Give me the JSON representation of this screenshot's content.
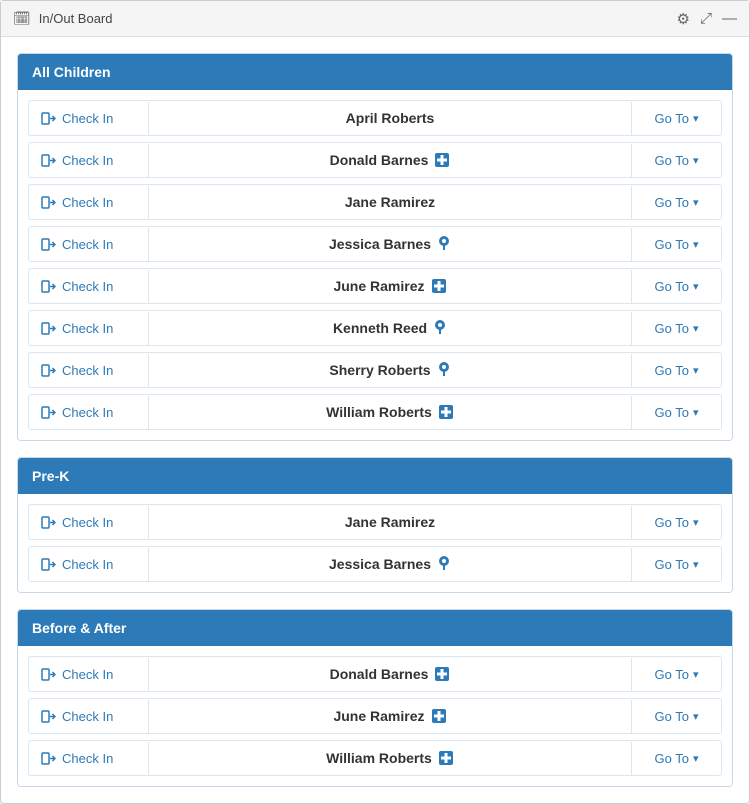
{
  "window": {
    "title": "In/Out Board",
    "title_icon": "📋"
  },
  "toolbar": {
    "settings_label": "⚙",
    "expand_label": "⛶",
    "close_label": "—"
  },
  "sections": [
    {
      "id": "all-children",
      "header": "All Children",
      "rows": [
        {
          "name": "April Roberts",
          "badge": null,
          "badge_type": null
        },
        {
          "name": "Donald Barnes",
          "badge": "📷",
          "badge_type": "med"
        },
        {
          "name": "Jane Ramirez",
          "badge": null,
          "badge_type": null
        },
        {
          "name": "Jessica Barnes",
          "badge": "📌",
          "badge_type": "pin"
        },
        {
          "name": "June Ramirez",
          "badge": "📷",
          "badge_type": "med"
        },
        {
          "name": "Kenneth Reed",
          "badge": "📌",
          "badge_type": "pin"
        },
        {
          "name": "Sherry Roberts",
          "badge": "📌",
          "badge_type": "pin"
        },
        {
          "name": "William Roberts",
          "badge": "📷",
          "badge_type": "med"
        }
      ]
    },
    {
      "id": "pre-k",
      "header": "Pre-K",
      "rows": [
        {
          "name": "Jane Ramirez",
          "badge": null,
          "badge_type": null
        },
        {
          "name": "Jessica Barnes",
          "badge": "📌",
          "badge_type": "pin"
        }
      ]
    },
    {
      "id": "before-after",
      "header": "Before & After",
      "rows": [
        {
          "name": "Donald Barnes",
          "badge": "📷",
          "badge_type": "med"
        },
        {
          "name": "June Ramirez",
          "badge": "📷",
          "badge_type": "med"
        },
        {
          "name": "William Roberts",
          "badge": "📷",
          "badge_type": "med"
        }
      ]
    }
  ],
  "labels": {
    "checkin": "Check In",
    "goto": "Go To",
    "chevron": "∨",
    "checkin_icon": "➜"
  }
}
